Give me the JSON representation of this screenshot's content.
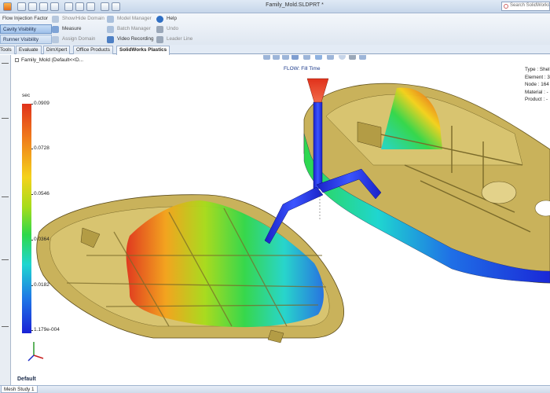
{
  "document_title": "Family_Mold.SLDPRT *",
  "search_placeholder": "Search SolidWorks",
  "ribbon": {
    "flow_injection_factor": "Flow Injection Factor",
    "show_hide_domain": "Show/Hide Domain",
    "model_manager": "Model Manager",
    "help": "Help",
    "measure": "Measure",
    "batch_manager": "Batch Manager",
    "undo": "Undo",
    "assign_domain": "Assign Domain",
    "video_recording": "Video Recording",
    "leader_line": "Leader Line",
    "dropdown": {
      "cavity_visibility": "Cavity Visibility",
      "runner_visibility": "Runner Visibility"
    }
  },
  "tabs": [
    "Tools",
    "Evaluate",
    "DimXpert",
    "Office Products",
    "SolidWorks Plastics"
  ],
  "active_tab": "SolidWorks Plastics",
  "tree_root": "Family_Mold (Default<<D...",
  "result_title": "FLOW: Fill Time",
  "info_panel": [
    "Type : Shel",
    "Element : 3",
    "Node : 164",
    "Material : -",
    "Product : -"
  ],
  "legend": {
    "unit": "sec",
    "ticks": [
      "0.0909",
      "0.0728",
      "0.0546",
      "0.0364",
      "0.0182",
      "1.179e-004"
    ]
  },
  "default_label": "Default",
  "status_tab": "Mesh Study 1",
  "colors": {
    "accent": "#c6d6ea",
    "active_tab": "#ffffff",
    "selected_item": "#9fc1ea",
    "part_body": "#c9b25b"
  },
  "icons": {
    "view_toolbar": [
      "zoom-fit-icon",
      "zoom-area-icon",
      "previous-view-icon",
      "section-view-icon",
      "view-orientation-icon",
      "display-style-icon",
      "hide-show-icon",
      "edit-appearance-icon",
      "apply-scene-icon",
      "view-settings-icon"
    ]
  }
}
